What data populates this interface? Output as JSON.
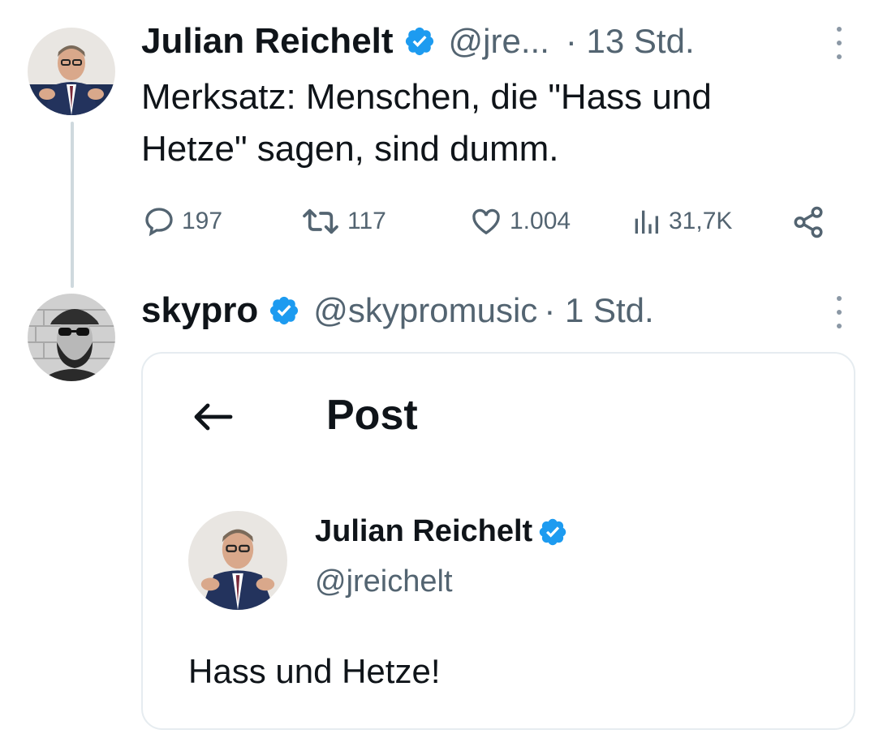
{
  "colors": {
    "verified": "#1d9bf0",
    "muted": "#536471",
    "border": "#e6ecf0",
    "text": "#0f1419"
  },
  "tweet1": {
    "display_name": "Julian Reichelt",
    "handle": "@jre...",
    "time": "· 13 Std.",
    "text_line1": "Merksatz: Menschen, die \"Hass und",
    "text_line2": "Hetze\" sagen, sind dumm.",
    "stats": {
      "replies": "197",
      "reposts": "117",
      "likes": "1.004",
      "views": "31,7K"
    },
    "icons": [
      "reply-icon",
      "repost-icon",
      "like-icon",
      "views-icon",
      "share-icon"
    ]
  },
  "tweet2": {
    "display_name": "skypro",
    "handle": "@skypromusic",
    "time": "· 1 Std.",
    "embed": {
      "header_title": "Post",
      "author_name": "Julian Reichelt",
      "author_handle": "@jreichelt",
      "text": "Hass und Hetze!"
    }
  }
}
